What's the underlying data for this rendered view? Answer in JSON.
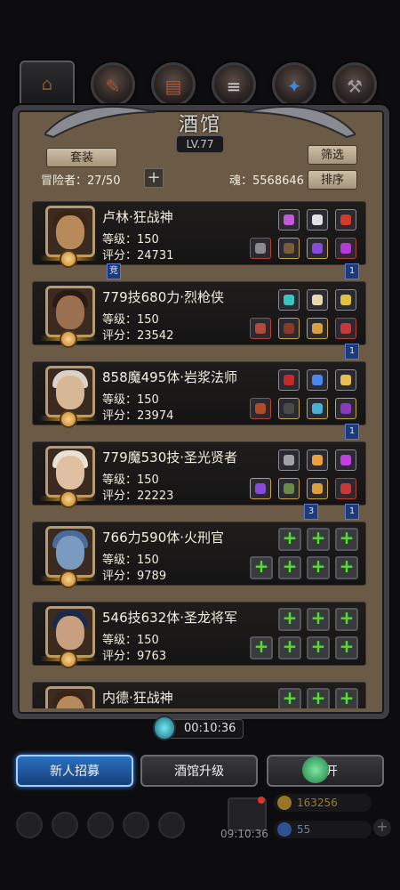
{
  "panel": {
    "title": "酒馆",
    "level": "LV.77",
    "outfit_button": "套装",
    "filter_button": "筛选",
    "sort_button": "排序",
    "adventurers_label": "冒险者：27/50",
    "soul_label": "魂：5568646"
  },
  "heroes": [
    {
      "name": "卢林·狂战神",
      "level": "等级：150",
      "score": "评分：24731"
    },
    {
      "name": "779技680力·烈枪侠",
      "level": "等级：150",
      "score": "评分：23542"
    },
    {
      "name": "858魔495体·岩浆法师",
      "level": "等级：150",
      "score": "评分：23974"
    },
    {
      "name": "779魔530技·圣光贤者",
      "level": "等级：150",
      "score": "评分：22223"
    },
    {
      "name": "766力590体·火刑官",
      "level": "等级：150",
      "score": "评分：9789"
    },
    {
      "name": "546技632体·圣龙将军",
      "level": "等级：150",
      "score": "评分：9763"
    },
    {
      "name": "内德·狂战神"
    }
  ],
  "tags": {
    "jing": "竞",
    "one": "1",
    "three": "3"
  },
  "timer": "00:10:36",
  "buttons": {
    "recruit": "新人招募",
    "upgrade": "酒馆升级",
    "leave": "离开"
  },
  "hud": {
    "clock": "09:10:36",
    "gold": "163256",
    "gems": "55"
  },
  "colors": {
    "panel_bg": "#6b5a45",
    "card_bg": "#1a1918",
    "recruit_blue": "#2a70c2",
    "plus_green": "#5bd63c"
  }
}
